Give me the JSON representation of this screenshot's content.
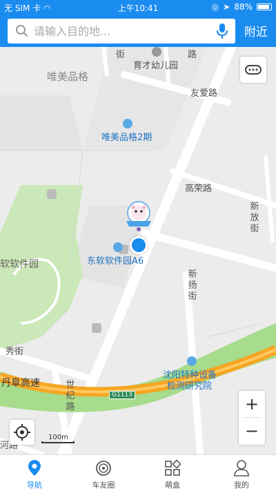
{
  "status_bar": {
    "carrier": "无 SIM 卡",
    "time": "上午10:41",
    "battery": "88%"
  },
  "search": {
    "placeholder": "请输入目的地...",
    "nearby_label": "附近"
  },
  "map": {
    "poi": {
      "kindergarten": "育才幼儿园",
      "weimei_area": "唯美品格",
      "weimei_phase2": "唯美品格2期",
      "neusoft_a6": "东软软件园A6",
      "neusoft_park": "软软件园",
      "sy_inspection_line1": "沈阳特种设备",
      "sy_inspection_line2": "检测研究院"
    },
    "roads": {
      "youai": "友爱路",
      "gaorong": "高荣路",
      "xinfang": "新放街",
      "xinyang": "新扬街",
      "shiji": "世纪路",
      "danfu": "丹阜高速",
      "xiu": "秀街",
      "he": "河路",
      "jie_top": "街",
      "lu_top": "路",
      "highway_shield": "G1113"
    },
    "scale_label": "100m",
    "zoom_in": "+",
    "zoom_out": "−"
  },
  "tabs": [
    {
      "label": "导航",
      "icon": "navigation-pin-icon",
      "active": true
    },
    {
      "label": "车友圈",
      "icon": "car-friends-icon",
      "active": false
    },
    {
      "label": "萌盒",
      "icon": "cute-box-icon",
      "active": false
    },
    {
      "label": "我的",
      "icon": "profile-icon",
      "active": false
    }
  ],
  "colors": {
    "brand_blue": "#1a8cf0",
    "highway_orange": "#f5a623",
    "highway_green": "#a6dc8c",
    "park_green": "#cbe8b8"
  }
}
